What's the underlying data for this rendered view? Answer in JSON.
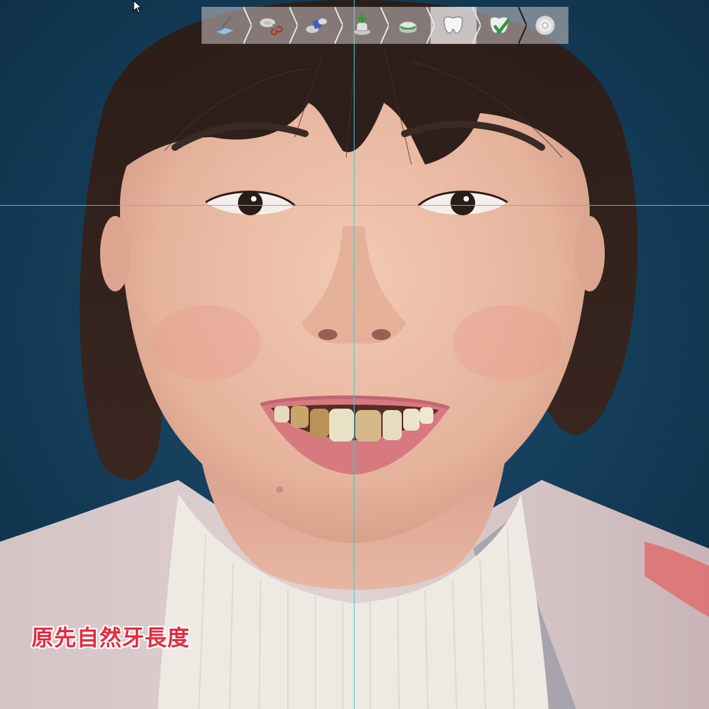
{
  "caption": "原先自然牙長度",
  "toolbar": {
    "steps": [
      {
        "name": "scan-tool-icon",
        "active": false
      },
      {
        "name": "cut-tool-icon",
        "active": false
      },
      {
        "name": "align-tool-icon",
        "active": false
      },
      {
        "name": "import-tool-icon",
        "active": false
      },
      {
        "name": "margin-tool-icon",
        "active": false
      },
      {
        "name": "tooth-design-icon",
        "active": true
      },
      {
        "name": "tooth-approve-icon",
        "active": false
      },
      {
        "name": "export-disc-icon",
        "active": false
      }
    ]
  },
  "colors": {
    "background": "#123a55",
    "guide_line": "#3ec8d8",
    "caption": "#e8293e"
  }
}
